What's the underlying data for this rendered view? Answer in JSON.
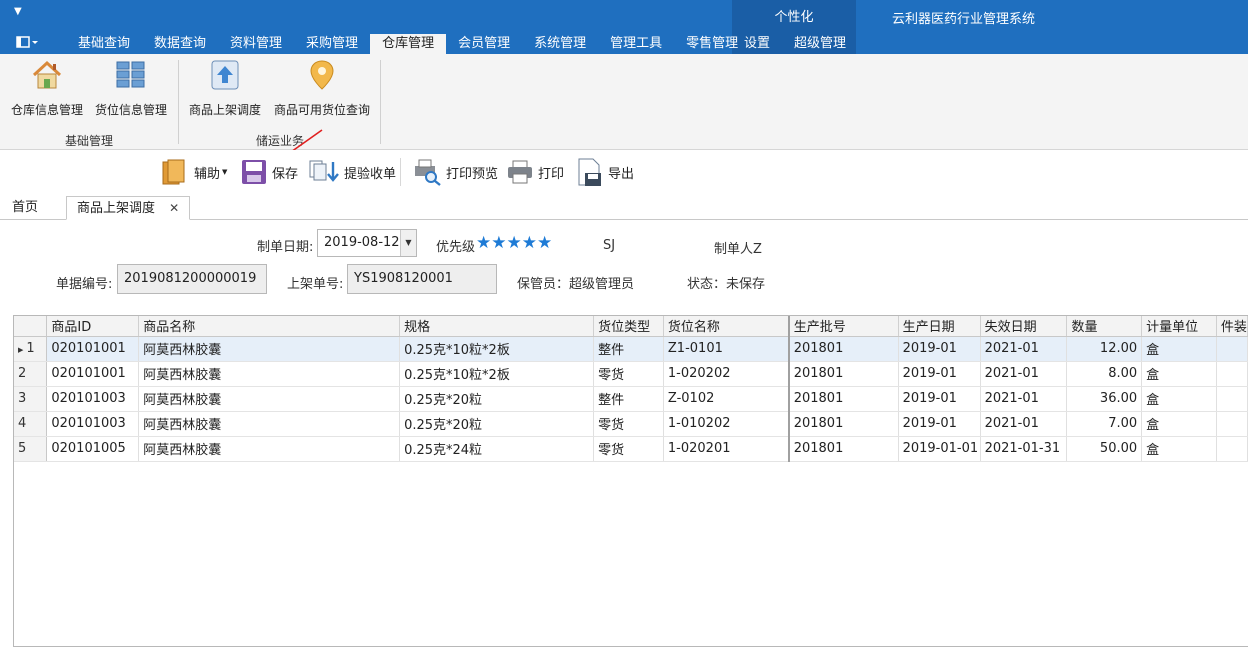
{
  "app": {
    "title": "云利器医药行业管理系统",
    "personalize_label": "个性化"
  },
  "ribbon_tabs": [
    "基础查询",
    "数据查询",
    "资料管理",
    "采购管理",
    "仓库管理",
    "会员管理",
    "系统管理",
    "管理工具",
    "零售管理"
  ],
  "ribbon_tabs_right": [
    "设置",
    "超级管理"
  ],
  "active_tab": "仓库管理",
  "ribbon": {
    "groups": [
      {
        "label": "基础管理",
        "items": [
          "仓库信息管理",
          "货位信息管理"
        ]
      },
      {
        "label": "储运业务",
        "items": [
          "商品上架调度",
          "商品可用货位查询"
        ]
      }
    ]
  },
  "toolbar": {
    "assist": "辅助",
    "save": "保存",
    "extract": "提验收单",
    "print_preview": "打印预览",
    "print": "打印",
    "export": "导出"
  },
  "doc_tabs": {
    "home": "首页",
    "current": "商品上架调度",
    "close_glyph": "✕"
  },
  "form": {
    "date_label": "制单日期:",
    "date_value": "2019-08-12",
    "priority_label": "优先级",
    "priority_stars": 5,
    "stars_text": "★★★★★",
    "sj": "SJ",
    "maker": "制单人Z",
    "doc_no_label": "单据编号:",
    "doc_no_value": "2019081200000019",
    "shelf_no_label": "上架单号:",
    "shelf_no_value": "YS1908120001",
    "keeper": "保管员：超级管理员",
    "status": "状态：未保存"
  },
  "grid": {
    "columns": [
      "商品ID",
      "商品名称",
      "规格",
      "货位类型",
      "货位名称",
      "生产批号",
      "生产日期",
      "失效日期",
      "数量",
      "计量单位",
      "件装"
    ],
    "rows": [
      {
        "no": "1",
        "id": "020101001",
        "name": "阿莫西林胶囊",
        "spec": "0.25克*10粒*2板",
        "loc_type": "整件",
        "loc_name": "Z1-0101",
        "batch": "201801",
        "mfg": "2019-01",
        "exp": "2021-01",
        "qty": "12.00",
        "unit": "盒",
        "pack": ""
      },
      {
        "no": "2",
        "id": "020101001",
        "name": "阿莫西林胶囊",
        "spec": "0.25克*10粒*2板",
        "loc_type": "零货",
        "loc_name": "1-020202",
        "batch": "201801",
        "mfg": "2019-01",
        "exp": "2021-01",
        "qty": "8.00",
        "unit": "盒",
        "pack": ""
      },
      {
        "no": "3",
        "id": "020101003",
        "name": "阿莫西林胶囊",
        "spec": "0.25克*20粒",
        "loc_type": "整件",
        "loc_name": "Z-0102",
        "batch": "201801",
        "mfg": "2019-01",
        "exp": "2021-01",
        "qty": "36.00",
        "unit": "盒",
        "pack": ""
      },
      {
        "no": "4",
        "id": "020101003",
        "name": "阿莫西林胶囊",
        "spec": "0.25克*20粒",
        "loc_type": "零货",
        "loc_name": "1-010202",
        "batch": "201801",
        "mfg": "2019-01",
        "exp": "2021-01",
        "qty": "7.00",
        "unit": "盒",
        "pack": ""
      },
      {
        "no": "5",
        "id": "020101005",
        "name": "阿莫西林胶囊",
        "spec": "0.25克*24粒",
        "loc_type": "零货",
        "loc_name": "1-020201",
        "batch": "201801",
        "mfg": "2019-01-01",
        "exp": "2021-01-31",
        "qty": "50.00",
        "unit": "盒",
        "pack": ""
      }
    ],
    "selected_row": 1
  }
}
